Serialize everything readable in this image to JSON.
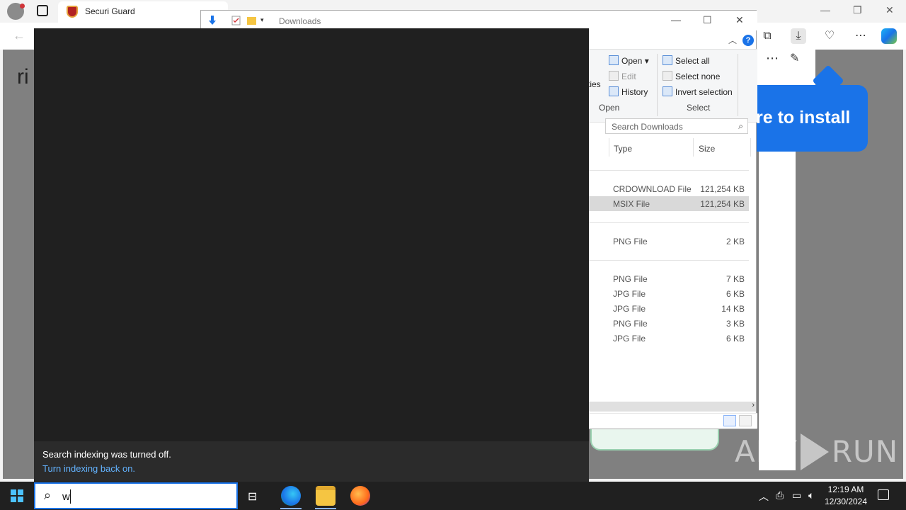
{
  "browser": {
    "tab_title": "Securi Guard",
    "page_partial_text": "ri",
    "install_banner_text": "re to install"
  },
  "explorer": {
    "window_title": "Downloads",
    "ribbon": {
      "partial_label": "rties",
      "open_items": [
        "Open",
        "Edit",
        "History"
      ],
      "select_items": [
        "Select all",
        "Select none",
        "Invert selection"
      ],
      "group_open": "Open",
      "group_select": "Select"
    },
    "search_placeholder": "Search Downloads",
    "columns": {
      "type": "Type",
      "size": "Size"
    },
    "files": [
      {
        "type": "CRDOWNLOAD File",
        "size": "121,254 KB",
        "selected": false
      },
      {
        "type": "MSIX File",
        "size": "121,254 KB",
        "selected": true
      },
      {
        "type": "PNG File",
        "size": "2 KB",
        "selected": false
      },
      {
        "type": "PNG File",
        "size": "7 KB",
        "selected": false
      },
      {
        "type": "JPG File",
        "size": "6 KB",
        "selected": false
      },
      {
        "type": "JPG File",
        "size": "14 KB",
        "selected": false
      },
      {
        "type": "PNG File",
        "size": "3 KB",
        "selected": false
      },
      {
        "type": "JPG File",
        "size": "6 KB",
        "selected": false
      }
    ]
  },
  "search_pane": {
    "notice": "Search indexing was turned off.",
    "link": "Turn indexing back on."
  },
  "watermark": {
    "left": "ANY",
    "right": "RUN"
  },
  "taskbar": {
    "search_value": "w",
    "time": "12:19 AM",
    "date": "12/30/2024"
  },
  "colors": {
    "accent": "#1a73e8",
    "link": "#63b3ff",
    "pane": "#202020"
  }
}
